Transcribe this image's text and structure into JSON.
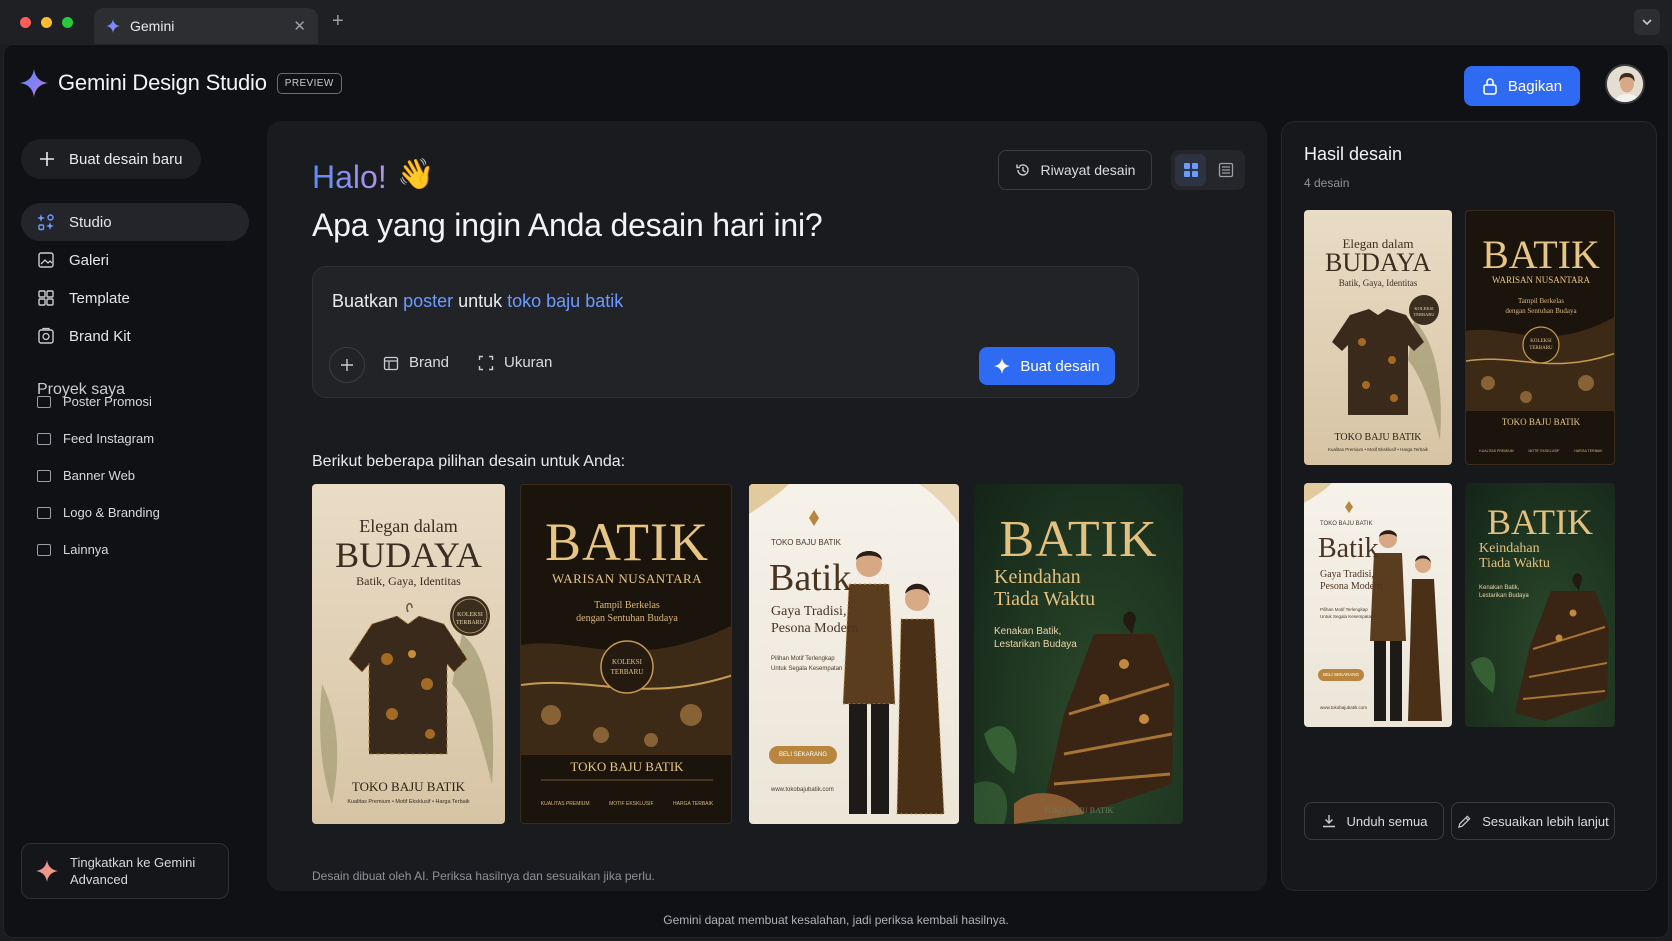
{
  "browser": {
    "tab_title": "Gemini"
  },
  "app": {
    "name": "Gemini Design Studio",
    "badge": "PREVIEW",
    "share_label": "Bagikan"
  },
  "sidebar": {
    "new_design": "Buat desain baru",
    "nav": [
      {
        "label": "Studio",
        "icon": "sparkle-grid-icon",
        "active": true
      },
      {
        "label": "Galeri",
        "icon": "image-icon"
      },
      {
        "label": "Template",
        "icon": "template-grid-icon"
      },
      {
        "label": "Brand Kit",
        "icon": "brand-kit-icon"
      }
    ],
    "projects_title": "Proyek saya",
    "projects": [
      "Poster Promosi",
      "Feed Instagram",
      "Banner Web",
      "Logo & Branding",
      "Lainnya"
    ],
    "upgrade_label": "Tingkatkan ke Gemini Advanced"
  },
  "main": {
    "greeting": "Halo!",
    "greeting_emoji": "👋",
    "headline": "Apa yang ingin Anda desain hari ini?",
    "history_label": "Riwayat desain",
    "prompt": {
      "part1": "Buatkan ",
      "highlight1": "poster",
      "part2": " untuk ",
      "highlight2": "toko baju batik"
    },
    "tools": {
      "brand": "Brand",
      "size": "Ukuran"
    },
    "create_label": "Buat desain",
    "options_label": "Berikut beberapa pilihan desain untuk Anda:",
    "footer_note": "Desain dibuat oleh AI. Periksa hasilnya dan sesuaikan jika perlu."
  },
  "posters": {
    "p1": {
      "line1": "Elegan dalam",
      "line2": "BUDAYA",
      "line3": "Batik, Gaya, Identitas",
      "badge1": "KOLEKSI",
      "badge2": "TERBARU",
      "store": "TOKO BAJU BATIK",
      "tagline": "Kualitas Premium • Motif Eksklusif • Harga Terbaik"
    },
    "p2": {
      "line1": "BATIK",
      "line2": "WARISAN NUSANTARA",
      "line3": "Tampil Berkelas",
      "line4": "dengan Sentuhan Budaya",
      "badge1": "KOLEKSI",
      "badge2": "TERBARU",
      "store": "TOKO BAJU BATIK",
      "f1": "KUALITAS PREMIUM",
      "f2": "MOTIF EKSKLUSIF",
      "f3": "HARGA TERBAIK"
    },
    "p3": {
      "store": "TOKO BAJU BATIK",
      "line1": "Batik",
      "line2": "Gaya Tradisi,",
      "line3": "Pesona Modern",
      "small1": "Pilihan Motif Terlengkap",
      "small2": "Untuk Segala Kesempatan",
      "cta": "BELI SEKARANG",
      "url": "www.tokobajubatik.com"
    },
    "p4": {
      "line1": "BATIK",
      "line2": "Keindahan",
      "line3": "Tiada Waktu",
      "small1": "Kenakan Batik,",
      "small2": "Lestarikan Budaya",
      "store": "TOKO BAJU BATIK"
    }
  },
  "results": {
    "title": "Hasil desain",
    "count": "4 desain",
    "download_label": "Unduh semua",
    "customize_label": "Sesuaikan lebih lanjut"
  },
  "disclaimer": "Gemini dapat membuat kesalahan, jadi periksa kembali hasilnya.",
  "colors": {
    "accent": "#2f6af3",
    "highlight": "#6c9bff",
    "background": "#101114"
  }
}
